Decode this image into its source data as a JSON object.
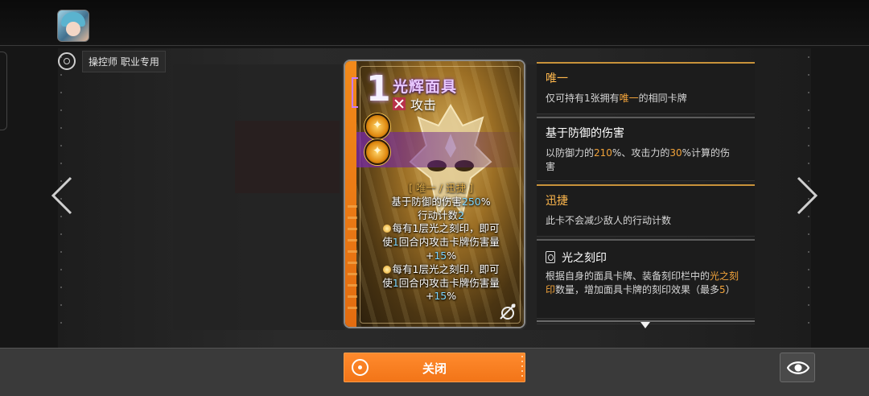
{
  "header": {
    "avatar_icon": "character-avatar",
    "mode_tag_label": "操控师 职业专用"
  },
  "navigation": {
    "prev_icon": "chevron-left-icon",
    "next_icon": "chevron-right-icon"
  },
  "card": {
    "cost": "1",
    "name": "光辉面具",
    "type_label": "攻击",
    "keywords_line": "[ 唯一 / 迅捷 ]",
    "desc_line1_prefix": "基于防御的伤害",
    "desc_line1_value": "250",
    "desc_line1_suffix": "%",
    "desc_line2_prefix": "行动计数",
    "desc_line2_value": "2",
    "effect1_a": "每有1层光之刻印，即可",
    "effect1_b_prefix": "使",
    "effect1_b_value": "1",
    "effect1_b_suffix": "回合内攻击卡牌伤害量",
    "effect1_c_prefix": "+",
    "effect1_c_value": "15",
    "effect1_c_suffix": "%",
    "effect2_a": "每有1层光之刻印，即可",
    "effect2_b_prefix": "使",
    "effect2_b_value": "1",
    "effect2_b_suffix": "回合内攻击卡牌伤害量",
    "effect2_c_prefix": "+",
    "effect2_c_value": "15",
    "effect2_c_suffix": "%",
    "accent_color": "#f28a1a"
  },
  "keywords": [
    {
      "title": "唯一",
      "desc_a": "仅可持有1张拥有",
      "desc_hl": "唯一",
      "desc_b": "的相同卡牌"
    },
    {
      "title": "基于防御的伤害",
      "desc_a": "以防御力的",
      "desc_v1": "210",
      "desc_b": "%、攻击力的",
      "desc_v2": "30",
      "desc_c": "%计算的伤",
      "desc_d": "害"
    },
    {
      "title": "迅捷",
      "desc": "此卡不会减少敌人的行动计数"
    },
    {
      "title": "光之刻印",
      "icon": "card-seal-icon",
      "desc_a": "根据自身的面具卡牌、装备刻印栏中的",
      "desc_hl": "光之刻印",
      "desc_b": "数量，增加面具卡牌的刻印效果（最多",
      "desc_v": "5",
      "desc_c": "）"
    }
  ],
  "footer": {
    "close_label": "关闭",
    "eye_icon": "eye-icon"
  }
}
